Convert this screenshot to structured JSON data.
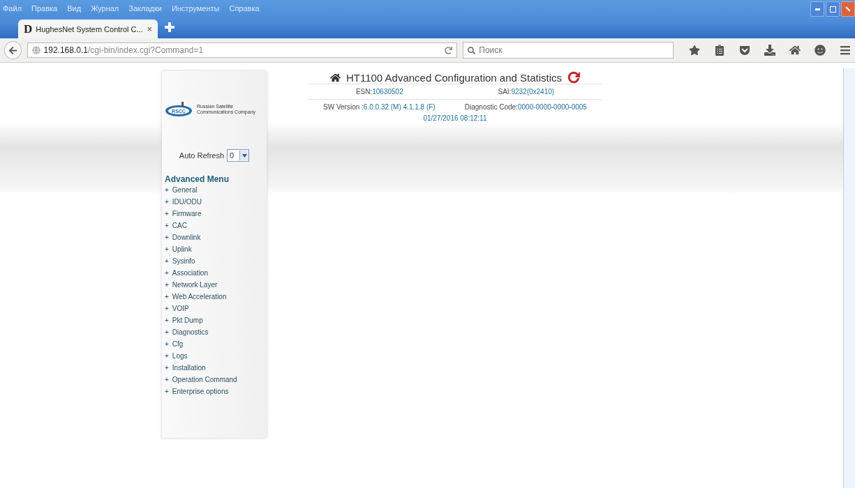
{
  "menu_bar": [
    "Файл",
    "Правка",
    "Вид",
    "Журнал",
    "Закладки",
    "Инструменты",
    "Справка"
  ],
  "tabs": [
    {
      "icon_letter": "D",
      "label": "HughesNet System Control C...",
      "close": "×",
      "selected": true
    }
  ],
  "address_bar": {
    "host": "192.168.0.1",
    "path": "/cgi-bin/index.cgi?Command=1"
  },
  "search": {
    "placeholder": "Поиск"
  },
  "logo": {
    "line_1": "Russian Satellite",
    "line_2": "Communications Company",
    "badge": "RSCC"
  },
  "header": {
    "title": "HT1100 Advanced Configuration and Statistics",
    "rows": [
      [
        {
          "label": "ESN:",
          "value": "10630502"
        },
        {
          "label": "SAI:",
          "value": "9232(0x2410)"
        }
      ],
      [
        {
          "label": "SW Version :",
          "value": "6.0.0.32 (M) 4.1.1.8 (F)"
        },
        {
          "label": "Diagnostic Code:",
          "value": "0000-0000-0000-0005"
        }
      ]
    ],
    "timestamp": "01/27/2016 08:12:11"
  },
  "auto_refresh": {
    "label": "Auto Refresh",
    "value": "0"
  },
  "advanced_menu": {
    "title": "Advanced Menu",
    "items": [
      {
        "bullet": "+",
        "label": "General"
      },
      {
        "bullet": "+",
        "label": "IDU/ODU"
      },
      {
        "bullet": "+",
        "label": "Firmware"
      },
      {
        "bullet": "+",
        "label": "CAC"
      },
      {
        "bullet": "+",
        "label": "Downlink"
      },
      {
        "bullet": "+",
        "label": "Uplink"
      },
      {
        "bullet": "+",
        "label": "Sysinfo"
      },
      {
        "bullet": "+",
        "label": "Association"
      },
      {
        "bullet": "+",
        "label": "Network Layer"
      },
      {
        "bullet": "+",
        "label": "Web Acceleration"
      },
      {
        "bullet": "+",
        "label": "VOIP"
      },
      {
        "bullet": "+",
        "label": "Pkt Dump"
      },
      {
        "bullet": "+",
        "label": "Diagnostics"
      },
      {
        "bullet": "+",
        "label": "Cfg"
      },
      {
        "bullet": "+",
        "label": "Logs"
      },
      {
        "bullet": "+",
        "label": "Installation"
      },
      {
        "bullet": "+",
        "label": "Operation Command"
      },
      {
        "bullet": "+",
        "label": "Enterprise options"
      }
    ]
  }
}
